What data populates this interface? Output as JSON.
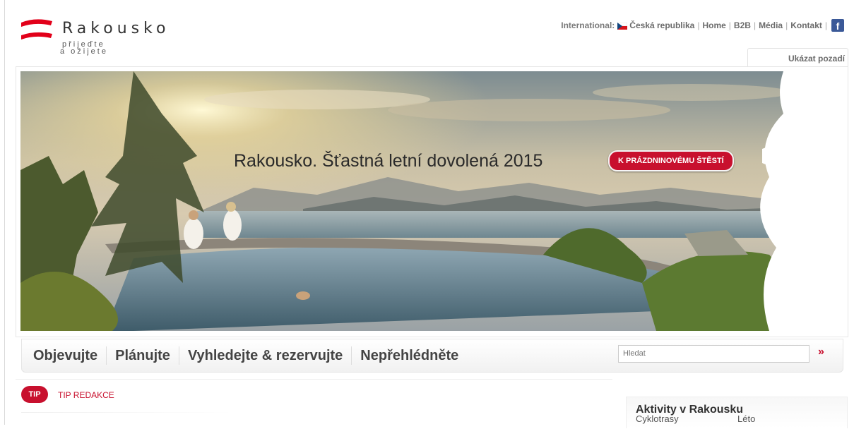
{
  "logo": {
    "title": "Rakousko",
    "subtitle_line1": "přijeďte",
    "subtitle_line2": "a ožijete"
  },
  "topnav": {
    "international_label": "International:",
    "country": "Česká republika",
    "links": [
      "Home",
      "B2B",
      "Média",
      "Kontakt"
    ],
    "facebook_icon": "facebook-icon"
  },
  "background_tab": {
    "label": "Ukázat pozadí"
  },
  "hero": {
    "title": "Rakousko. Šťastná letní dovolená 2015",
    "button_label": "K PRÁZDNINOVÉMU ŠTĚSTÍ"
  },
  "mainnav": {
    "items": [
      "Objevujte",
      "Plánujte",
      "Vyhledejte & rezervujte",
      "Nepřehlédněte"
    ],
    "search_placeholder": "Hledat",
    "search_go": "»"
  },
  "tip": {
    "badge": "TIP",
    "label": "TIP REDAKCE"
  },
  "aside": {
    "title": "Aktivity v Rakousku",
    "left_item": "Cyklotrasy",
    "right_item": "Léto"
  },
  "colors": {
    "brand_red": "#c8102e",
    "text_dark": "#333333"
  }
}
